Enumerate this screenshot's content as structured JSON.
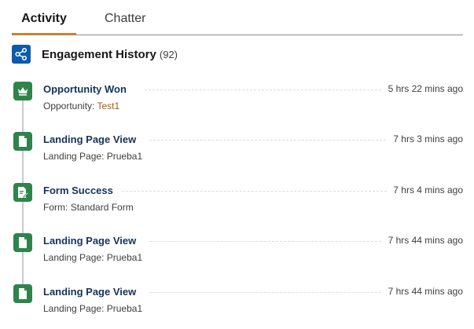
{
  "tabs": [
    {
      "label": "Activity",
      "active": true
    },
    {
      "label": "Chatter",
      "active": false
    }
  ],
  "header": {
    "icon": "share-icon",
    "title": "Engagement History",
    "count": "(92)"
  },
  "colors": {
    "accent_tab": "#cc8030",
    "header_icon_bg": "#0b5cab",
    "item_icon_bg": "#2e844a",
    "item_title": "#16325c",
    "link": "#a25d0e"
  },
  "items": [
    {
      "title": "Opportunity Won",
      "time": "5 hrs 22 mins ago",
      "detail_label": "Opportunity:",
      "detail_value": "Test1",
      "icon": "crown-icon"
    },
    {
      "title": "Landing Page View",
      "time": "7 hrs 3 mins ago",
      "detail_label": "Landing Page:",
      "detail_value": "Prueba1",
      "icon": "document-icon"
    },
    {
      "title": "Form Success",
      "time": "7 hrs 4 mins ago",
      "detail_label": "Form:",
      "detail_value": "Standard Form",
      "icon": "form-icon"
    },
    {
      "title": "Landing Page View",
      "time": "7 hrs 44 mins ago",
      "detail_label": "Landing Page:",
      "detail_value": "Prueba1",
      "icon": "document-icon"
    },
    {
      "title": "Landing Page View",
      "time": "7 hrs 44 mins ago",
      "detail_label": "Landing Page:",
      "detail_value": "Prueba1",
      "icon": "document-icon"
    }
  ]
}
